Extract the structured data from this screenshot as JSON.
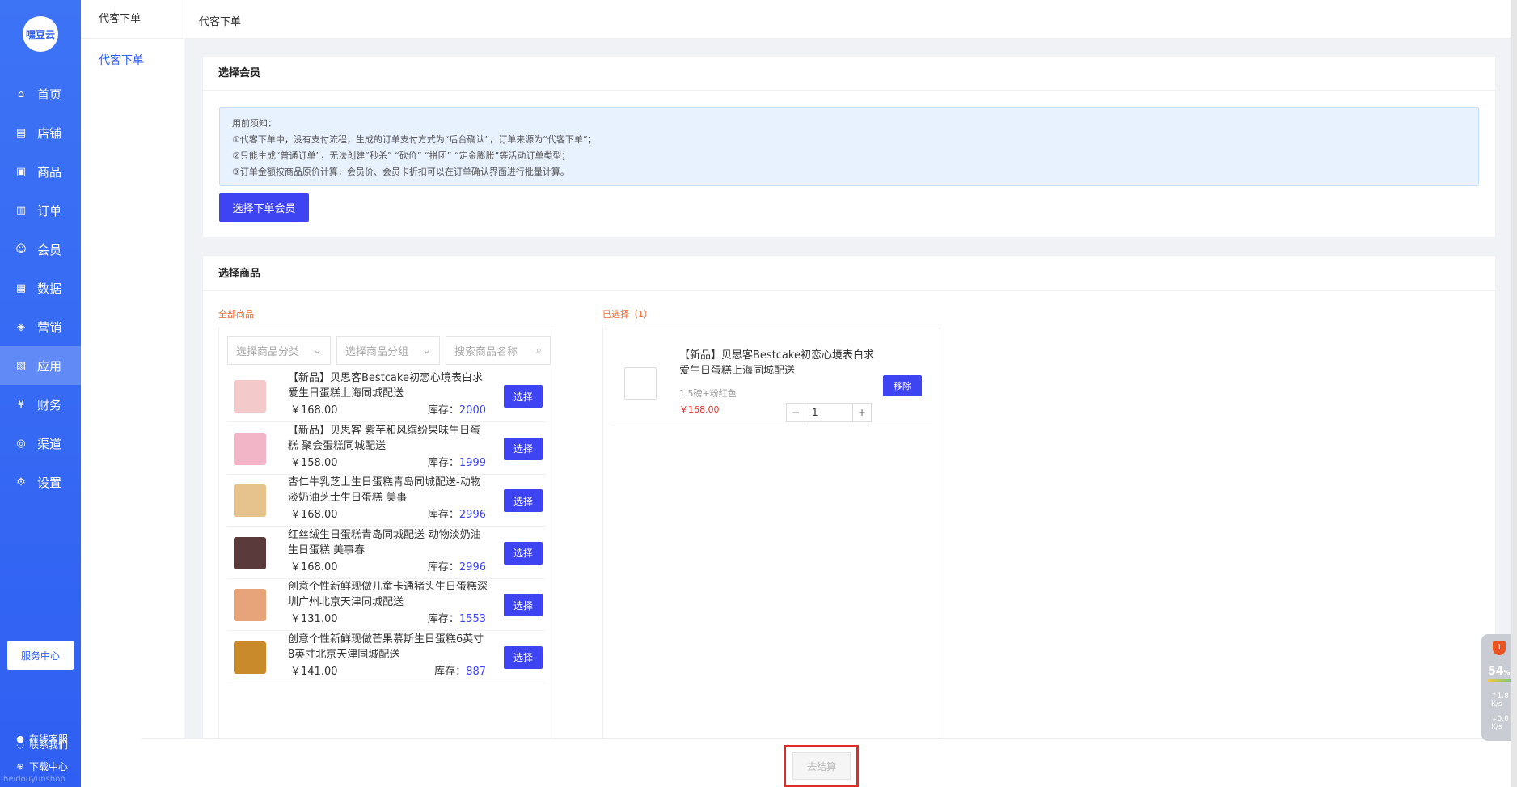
{
  "sidebar": {
    "logo_text": "嘿豆云",
    "items": [
      {
        "label": "首页",
        "icon": "home-icon",
        "glyph": "⌂"
      },
      {
        "label": "店铺",
        "icon": "store-icon",
        "glyph": "▤"
      },
      {
        "label": "商品",
        "icon": "goods-icon",
        "glyph": "▣"
      },
      {
        "label": "订单",
        "icon": "order-icon",
        "glyph": "▥"
      },
      {
        "label": "会员",
        "icon": "member-icon",
        "glyph": "☺"
      },
      {
        "label": "数据",
        "icon": "data-icon",
        "glyph": "▦"
      },
      {
        "label": "营销",
        "icon": "tag-icon",
        "glyph": "◈"
      },
      {
        "label": "应用",
        "icon": "app-icon",
        "glyph": "▧"
      },
      {
        "label": "财务",
        "icon": "finance-icon",
        "glyph": "¥"
      },
      {
        "label": "渠道",
        "icon": "channel-icon",
        "glyph": "◎"
      },
      {
        "label": "设置",
        "icon": "settings-icon",
        "glyph": "⚙"
      }
    ],
    "active_index": 7,
    "service_center": "服务中心",
    "online_service": "在线客服",
    "download_center": "下载中心",
    "contact_us": "联系我们",
    "watermark": "heidouyunshop"
  },
  "subbar": {
    "title": "代客下单",
    "item": "代客下单"
  },
  "topbar": {
    "title": "代客下单"
  },
  "member_section": {
    "title": "选择会员",
    "notice": [
      "用前须知：",
      "①代客下单中，没有支付流程，生成的订单支付方式为“后台确认”，订单来源为“代客下单”；",
      "②只能生成“普通订单”，无法创建“秒杀” “砍价” “拼团” “定金膨胀”等活动订单类型；",
      "③订单金额按商品原价计算，会员价、会员卡折扣可以在订单确认界面进行批量计算。"
    ],
    "button": "选择下单会员"
  },
  "goods_section": {
    "title": "选择商品",
    "all_label": "全部商品",
    "selected_label": "已选择（1）",
    "filters": {
      "category": "选择商品分类",
      "group": "选择商品分组",
      "search_placeholder": "搜索商品名称"
    },
    "stock_label": "库存：",
    "select_button": "选择",
    "products": [
      {
        "name": "【新品】贝思客Bestcake初恋心境表白求爱生日蛋糕上海同城配送",
        "price": "￥168.00",
        "stock": "2000",
        "color": "#f3c9c9"
      },
      {
        "name": "【新品】贝思客 紫芋和风缤纷果味生日蛋糕 聚会蛋糕同城配送",
        "price": "￥158.00",
        "stock": "1999",
        "color": "#f2b5c8"
      },
      {
        "name": "杏仁牛乳芝士生日蛋糕青岛同城配送-动物淡奶油芝士生日蛋糕 美事",
        "price": "￥168.00",
        "stock": "2996",
        "color": "#e6c28c"
      },
      {
        "name": "红丝绒生日蛋糕青岛同城配送-动物淡奶油生日蛋糕 美事春",
        "price": "￥168.00",
        "stock": "2996",
        "color": "#5a3a3a"
      },
      {
        "name": "创意个性新鲜现做儿童卡通猪头生日蛋糕深圳广州北京天津同城配送",
        "price": "￥131.00",
        "stock": "1553",
        "color": "#e7a37a"
      },
      {
        "name": "创意个性新鲜现做芒果慕斯生日蛋糕6英寸8英寸北京天津同城配送",
        "price": "￥141.00",
        "stock": "887",
        "color": "#c98a2c"
      }
    ],
    "selected": {
      "name": "【新品】贝思客Bestcake初恋心境表白求爱生日蛋糕上海同城配送",
      "spec": "1.5磅+粉红色",
      "price": "￥168.00",
      "quantity": "1",
      "remove_button": "移除",
      "minus": "−",
      "plus": "+"
    }
  },
  "checkout": {
    "button": "去结算"
  },
  "widget": {
    "badge": "1",
    "percent": "54",
    "percent_unit": "%",
    "up": "1.8",
    "down": "0.0",
    "unit": "K/s"
  }
}
